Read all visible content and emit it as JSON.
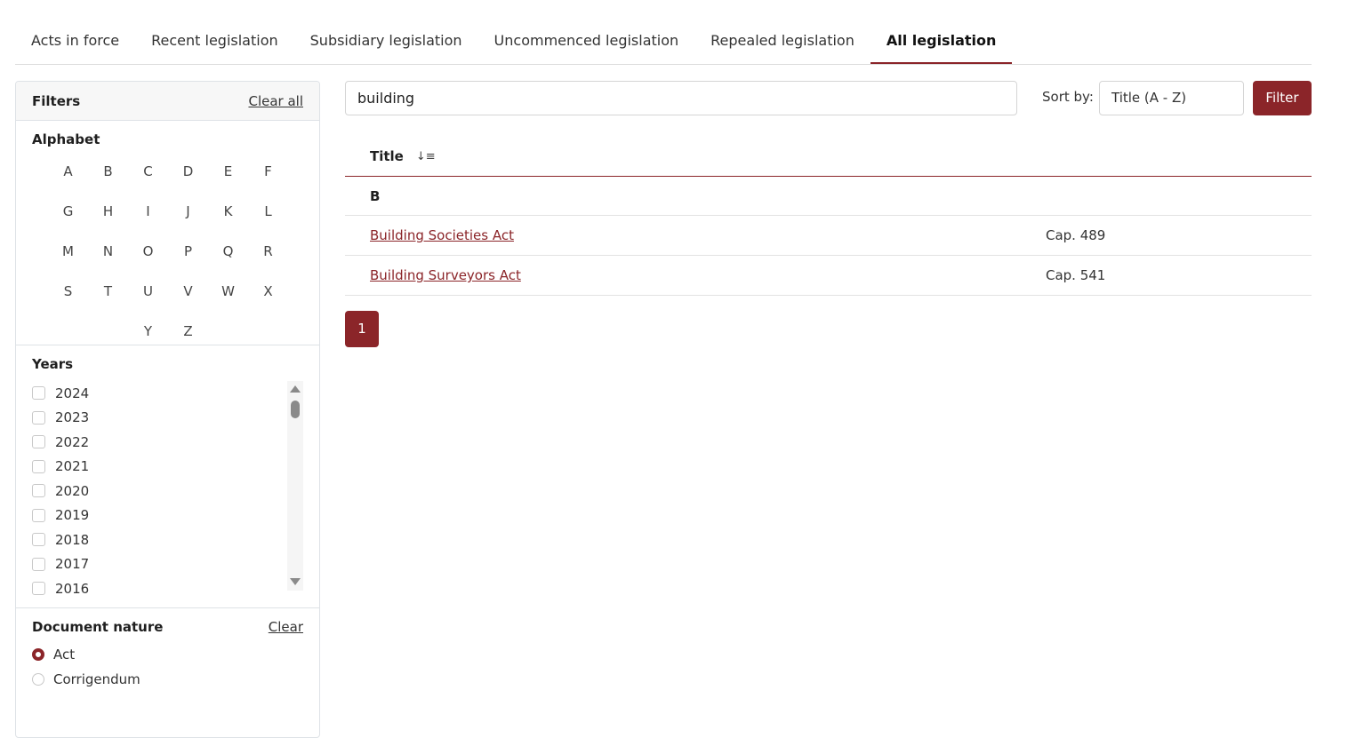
{
  "tabs": [
    {
      "label": "Acts in force",
      "active": false
    },
    {
      "label": "Recent legislation",
      "active": false
    },
    {
      "label": "Subsidiary legislation",
      "active": false
    },
    {
      "label": "Uncommenced legislation",
      "active": false
    },
    {
      "label": "Repealed legislation",
      "active": false
    },
    {
      "label": "All legislation",
      "active": true
    }
  ],
  "filters": {
    "title": "Filters",
    "clear_all": "Clear all",
    "alphabet": {
      "title": "Alphabet",
      "letters": [
        "A",
        "B",
        "C",
        "D",
        "E",
        "F",
        "G",
        "H",
        "I",
        "J",
        "K",
        "L",
        "M",
        "N",
        "O",
        "P",
        "Q",
        "R",
        "S",
        "T",
        "U",
        "V",
        "W",
        "X",
        "Y",
        "Z"
      ]
    },
    "years": {
      "title": "Years",
      "items": [
        "2024",
        "2023",
        "2022",
        "2021",
        "2020",
        "2019",
        "2018",
        "2017",
        "2016"
      ]
    },
    "document_nature": {
      "title": "Document nature",
      "clear": "Clear",
      "options": [
        {
          "label": "Act",
          "selected": true
        },
        {
          "label": "Corrigendum",
          "selected": false
        }
      ]
    }
  },
  "search": {
    "value": "building"
  },
  "sort": {
    "label": "Sort by:",
    "value": "Title (A - Z)"
  },
  "filter_button": "Filter",
  "results": {
    "header_title": "Title",
    "sort_icon": "↓≡",
    "groups": [
      {
        "letter": "B",
        "rows": [
          {
            "title": "Building Societies Act",
            "cap": "Cap. 489"
          },
          {
            "title": "Building Surveyors Act",
            "cap": "Cap. 541"
          }
        ]
      }
    ]
  },
  "pagination": {
    "current": "1"
  },
  "colors": {
    "accent": "#8b2529"
  }
}
